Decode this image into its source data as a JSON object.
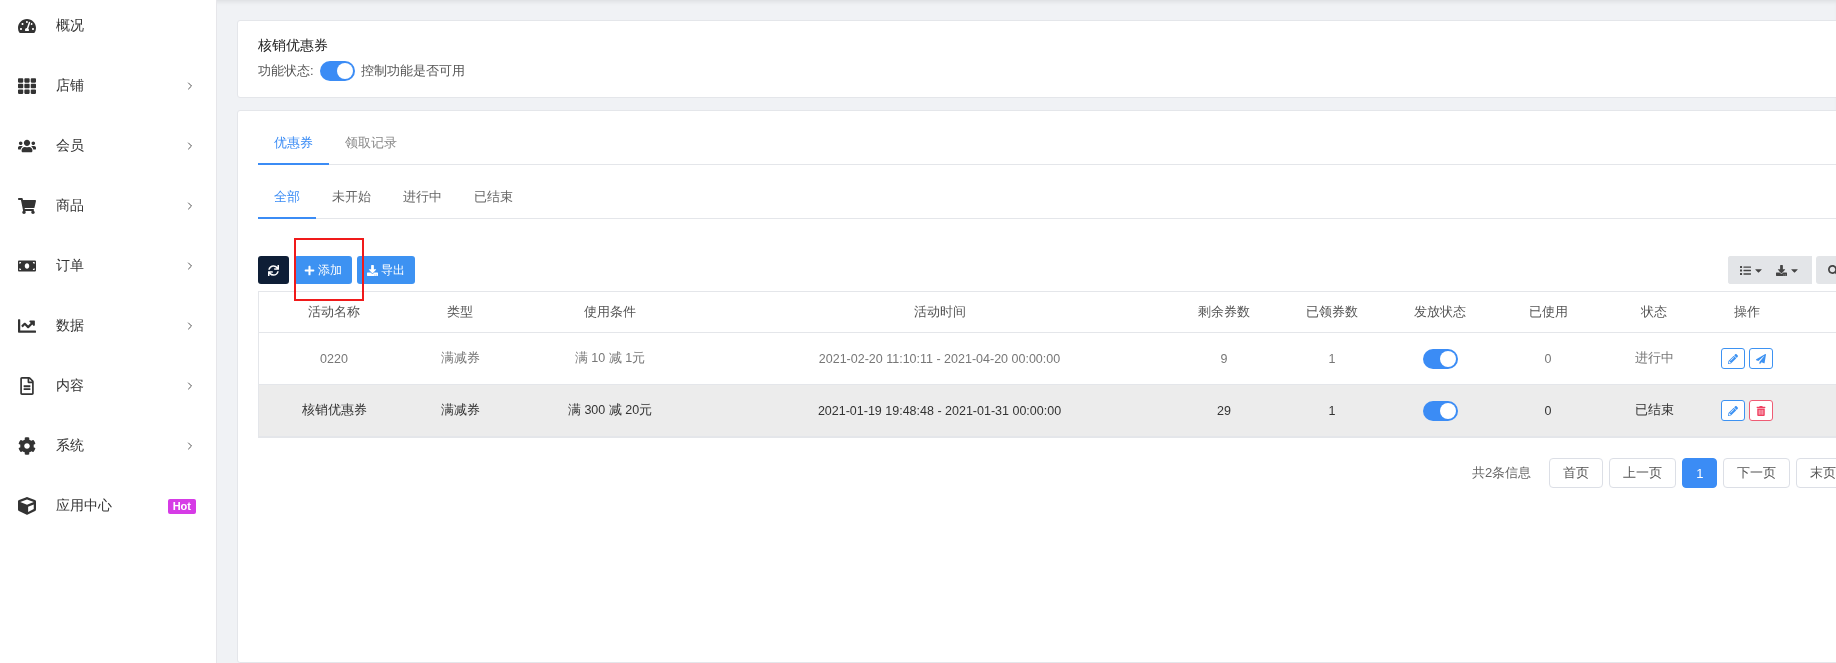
{
  "sidebar": {
    "items": [
      {
        "label": "概况",
        "has_submenu": false
      },
      {
        "label": "店铺",
        "has_submenu": true
      },
      {
        "label": "会员",
        "has_submenu": true
      },
      {
        "label": "商品",
        "has_submenu": true
      },
      {
        "label": "订单",
        "has_submenu": true
      },
      {
        "label": "数据",
        "has_submenu": true
      },
      {
        "label": "内容",
        "has_submenu": true
      },
      {
        "label": "系统",
        "has_submenu": true
      },
      {
        "label": "应用中心",
        "has_submenu": false,
        "badge": "Hot"
      }
    ]
  },
  "feature_card": {
    "title": "核销优惠券",
    "status_label": "功能状态:",
    "on": true,
    "hint": "控制功能是否可用"
  },
  "tabs": [
    {
      "label": "优惠券",
      "selected": true
    },
    {
      "label": "领取记录",
      "selected": false
    }
  ],
  "sub_tabs": [
    {
      "label": "全部",
      "selected": true
    },
    {
      "label": "未开始",
      "selected": false
    },
    {
      "label": "进行中",
      "selected": false
    },
    {
      "label": "已结束",
      "selected": false
    }
  ],
  "toolbar": {
    "add_label": "添加",
    "export_label": "导出",
    "add_highlighted": true
  },
  "table": {
    "columns": [
      "活动名称",
      "类型",
      "使用条件",
      "活动时间",
      "剩余券数",
      "已领券数",
      "发放状态",
      "已使用",
      "状态",
      "操作"
    ],
    "rows": [
      {
        "highlighted": false,
        "cells": [
          "0220",
          "满减券",
          "满 10 减 1元",
          "2021-02-20 11:10:11 - 2021-04-20 00:00:00",
          "9",
          "1"
        ],
        "issuing": true,
        "used": "0",
        "status": "进行中",
        "actions": [
          {
            "kind": "edit"
          },
          {
            "kind": "send"
          }
        ]
      },
      {
        "highlighted": true,
        "cells": [
          "核销优惠券",
          "满减券",
          "满 300 减 20元",
          "2021-01-19 19:48:48 - 2021-01-31 00:00:00",
          "29",
          "1"
        ],
        "issuing": true,
        "used": "0",
        "status": "已结束",
        "actions": [
          {
            "kind": "edit"
          },
          {
            "kind": "delete"
          }
        ]
      }
    ]
  },
  "pagination": {
    "summary": "共2条信息",
    "first": "首页",
    "prev": "上一页",
    "pages": [
      {
        "label": "1",
        "selected": true
      }
    ],
    "next": "下一页",
    "last": "末页"
  }
}
